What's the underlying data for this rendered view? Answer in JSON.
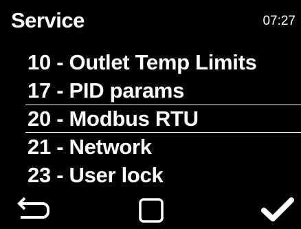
{
  "header": {
    "title": "Service",
    "time": "07:27"
  },
  "menu": {
    "items": [
      {
        "label": "10 - Outlet Temp Limits",
        "selected": false
      },
      {
        "label": "17 - PID params",
        "selected": false
      },
      {
        "label": "20 - Modbus RTU",
        "selected": true
      },
      {
        "label": "21 - Network",
        "selected": false
      },
      {
        "label": "23 - User lock",
        "selected": false
      }
    ]
  },
  "footer": {
    "back_icon": "back-arrow-icon",
    "home_icon": "square-icon",
    "confirm_icon": "checkmark-icon"
  },
  "colors": {
    "background": "#000000",
    "foreground": "#ffffff"
  }
}
